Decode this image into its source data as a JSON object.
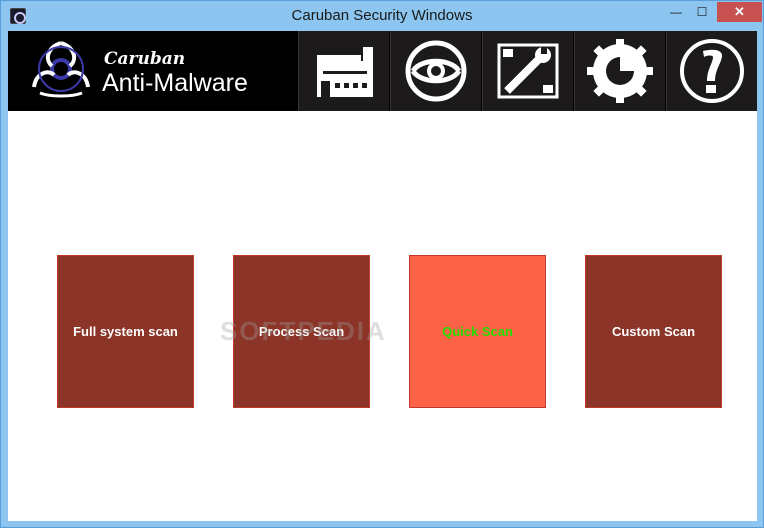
{
  "window": {
    "title": "Caruban Security Windows",
    "minimize_glyph": "—",
    "maximize_glyph": "☐",
    "close_glyph": "✕"
  },
  "logo": {
    "line1": "Caruban",
    "line2": "Anti-Malware"
  },
  "nav": [
    {
      "icon": "building-icon"
    },
    {
      "icon": "eye-scan-icon"
    },
    {
      "icon": "wrench-tools-icon"
    },
    {
      "icon": "gear-update-icon"
    },
    {
      "icon": "exclamation-help-icon"
    }
  ],
  "scans": [
    {
      "label": "Full system scan",
      "active": false
    },
    {
      "label": "Process Scan",
      "active": false
    },
    {
      "label": "Quick Scan",
      "active": true
    },
    {
      "label": "Custom Scan",
      "active": false
    }
  ],
  "watermark": "SOFTPEDIA",
  "colors": {
    "tile": "#8b3427",
    "tile_active": "#ff6347",
    "active_text": "#22dd00",
    "header": "#000000",
    "titlebar": "#8cc5ef"
  }
}
